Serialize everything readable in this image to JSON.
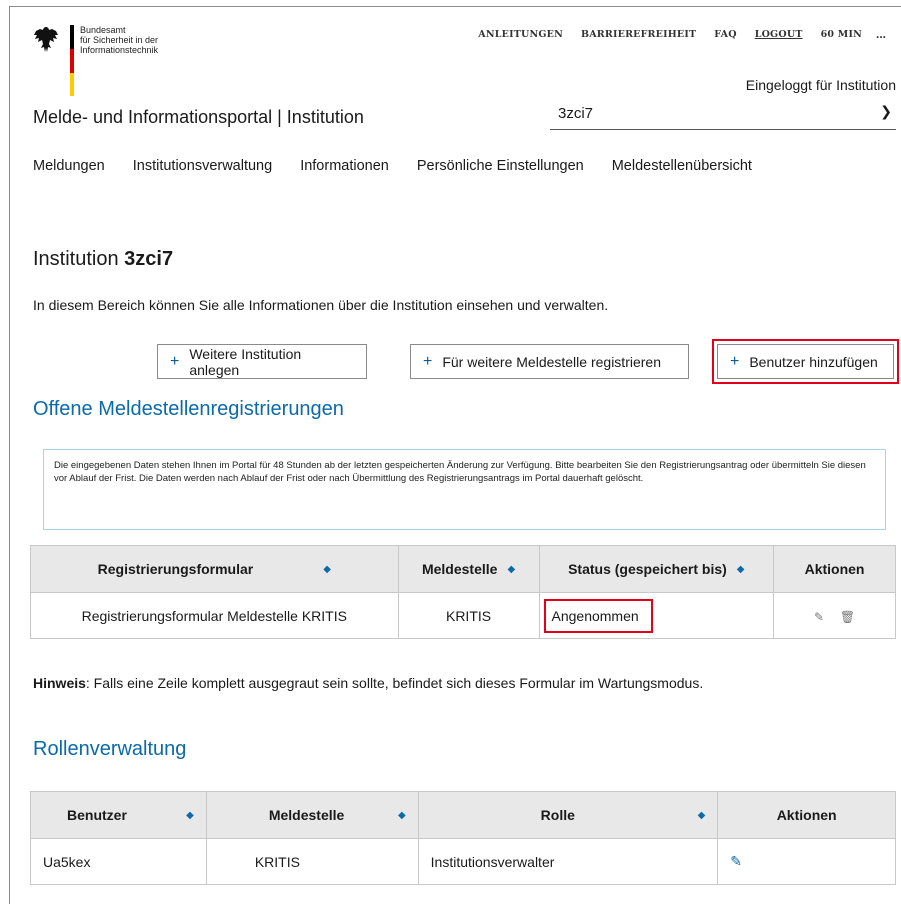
{
  "logo": {
    "line1": "Bundesamt",
    "line2": "für Sicherheit in der",
    "line3": "Informationstechnik"
  },
  "topnav": {
    "guides": "ANLEITUNGEN",
    "accessibility": "BARRIEREFREIHEIT",
    "faq": "FAQ",
    "logout": "LOGOUT",
    "timer": "60 MIN",
    "more": "..."
  },
  "header": {
    "logged_in": "Eingeloggt für Institution",
    "portal_title": "Melde- und Informationsportal | Institution",
    "institution_select": "3zci7"
  },
  "mainnav": [
    "Meldungen",
    "Institutionsverwaltung",
    "Informationen",
    "Persönliche Einstellungen",
    "Meldestellenübersicht"
  ],
  "page": {
    "title_prefix": "Institution ",
    "title_name": "3zci7",
    "intro": "In diesem Bereich können Sie alle Informationen über die Institution einsehen und verwalten."
  },
  "buttons": {
    "add_institution": "Weitere Institution anlegen",
    "register_office": "Für weitere Meldestelle registrieren",
    "add_user": "Benutzer hinzufügen"
  },
  "registrations": {
    "heading": "Offene Meldestellenregistrierungen",
    "info": "Die eingegebenen Daten stehen Ihnen im Portal für 48 Stunden ab der letzten gespeicherten Änderung zur Verfügung. Bitte bearbeiten Sie den Registrierungsantrag oder übermitteln Sie diesen vor Ablauf der Frist. Die Daten werden nach Ablauf der Frist oder nach Übermittlung des Registrierungsantrags im Portal dauerhaft gelöscht.",
    "columns": [
      "Registrierungsformular",
      "Meldestelle",
      "Status (gespeichert bis)",
      "Aktionen"
    ],
    "rows": [
      {
        "form": "Registrierungsformular Meldestelle KRITIS",
        "office": "KRITIS",
        "status": "Angenommen"
      }
    ]
  },
  "hint": {
    "label": "Hinweis",
    "text": ": Falls eine Zeile komplett ausgegraut sein sollte, befindet sich dieses Formular im Wartungsmodus."
  },
  "roles": {
    "heading": "Rollenverwaltung",
    "columns": [
      "Benutzer",
      "Meldestelle",
      "Rolle",
      "Aktionen"
    ],
    "rows": [
      {
        "user": "Ua5kex",
        "office": "KRITIS",
        "role": "Institutionsverwalter"
      }
    ]
  },
  "colors": {
    "accent": "#0b6aa8",
    "highlight": "#e3001b",
    "header_bg": "#e8e8e8"
  },
  "icons": {
    "sort": "sort-arrows-icon",
    "edit": "pencil-icon",
    "delete": "trash-icon",
    "select": "chevron-down-icon",
    "add": "plus-icon"
  }
}
